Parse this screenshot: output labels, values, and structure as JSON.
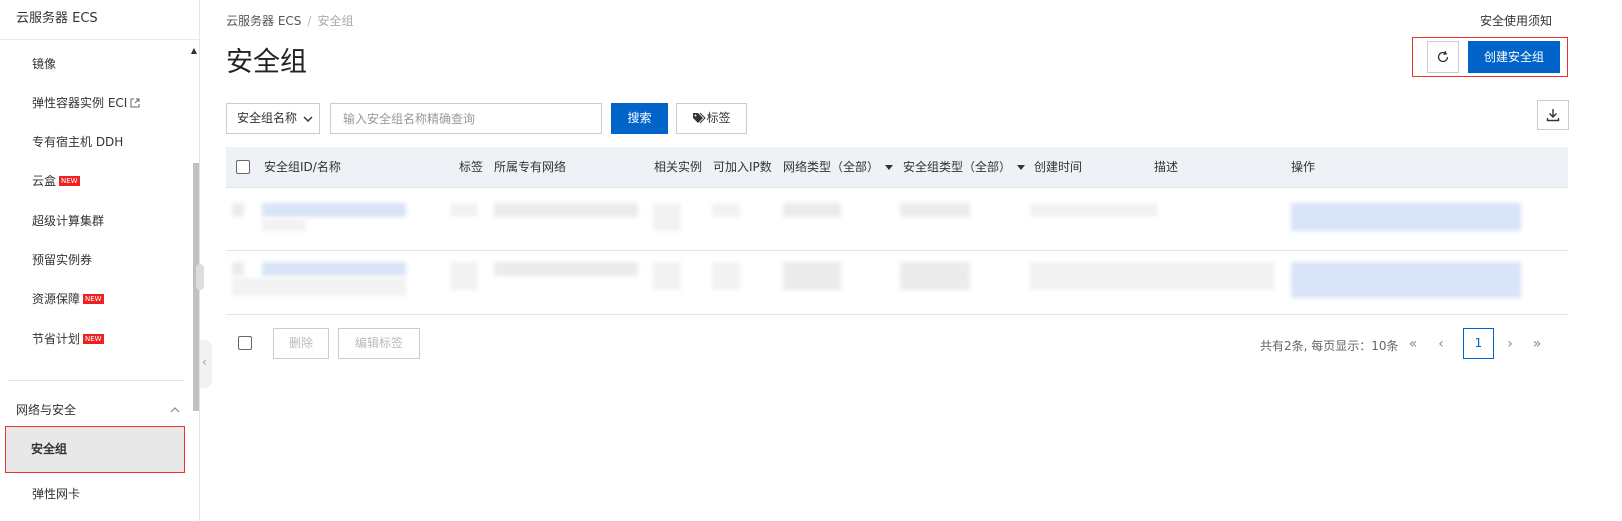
{
  "sidebar": {
    "title": "云服务器 ECS",
    "items": [
      {
        "label": "镜像"
      },
      {
        "label": "弹性容器实例 ECI",
        "external": true
      },
      {
        "label": "专有宿主机 DDH"
      },
      {
        "label": "云盒",
        "badge": "NEW"
      },
      {
        "label": "超级计算集群"
      },
      {
        "label": "预留实例券"
      },
      {
        "label": "资源保障",
        "badge": "NEW"
      },
      {
        "label": "节省计划",
        "badge": "NEW"
      }
    ],
    "group": {
      "label": "网络与安全",
      "expanded": true
    },
    "group_items": [
      {
        "label": "安全组",
        "active": true
      },
      {
        "label": "弹性网卡"
      }
    ]
  },
  "header": {
    "breadcrumb": [
      "云服务器 ECS",
      "安全组"
    ],
    "breadcrumb_sep": "/",
    "title": "安全组",
    "notice_link": "安全使用须知",
    "create_button": "创建安全组"
  },
  "toolbar": {
    "filter_select": "安全组名称",
    "search_placeholder": "输入安全组名称精确查询",
    "search_button": "搜索",
    "tag_button": "标签"
  },
  "table": {
    "columns": [
      "安全组ID/名称",
      "标签",
      "所属专有网络",
      "相关实例",
      "可加入IP数",
      "网络类型（全部）",
      "安全组类型（全部）",
      "创建时间",
      "描述",
      "操作"
    ],
    "row_count": 2
  },
  "footer": {
    "delete_button": "删除",
    "edit_tags_button": "编辑标签",
    "summary": "共有2条, 每页显示：10条",
    "current_page": "1"
  },
  "colors": {
    "primary": "#0064c8",
    "highlight_border": "#e8342b",
    "new_badge": "#ee2222"
  }
}
